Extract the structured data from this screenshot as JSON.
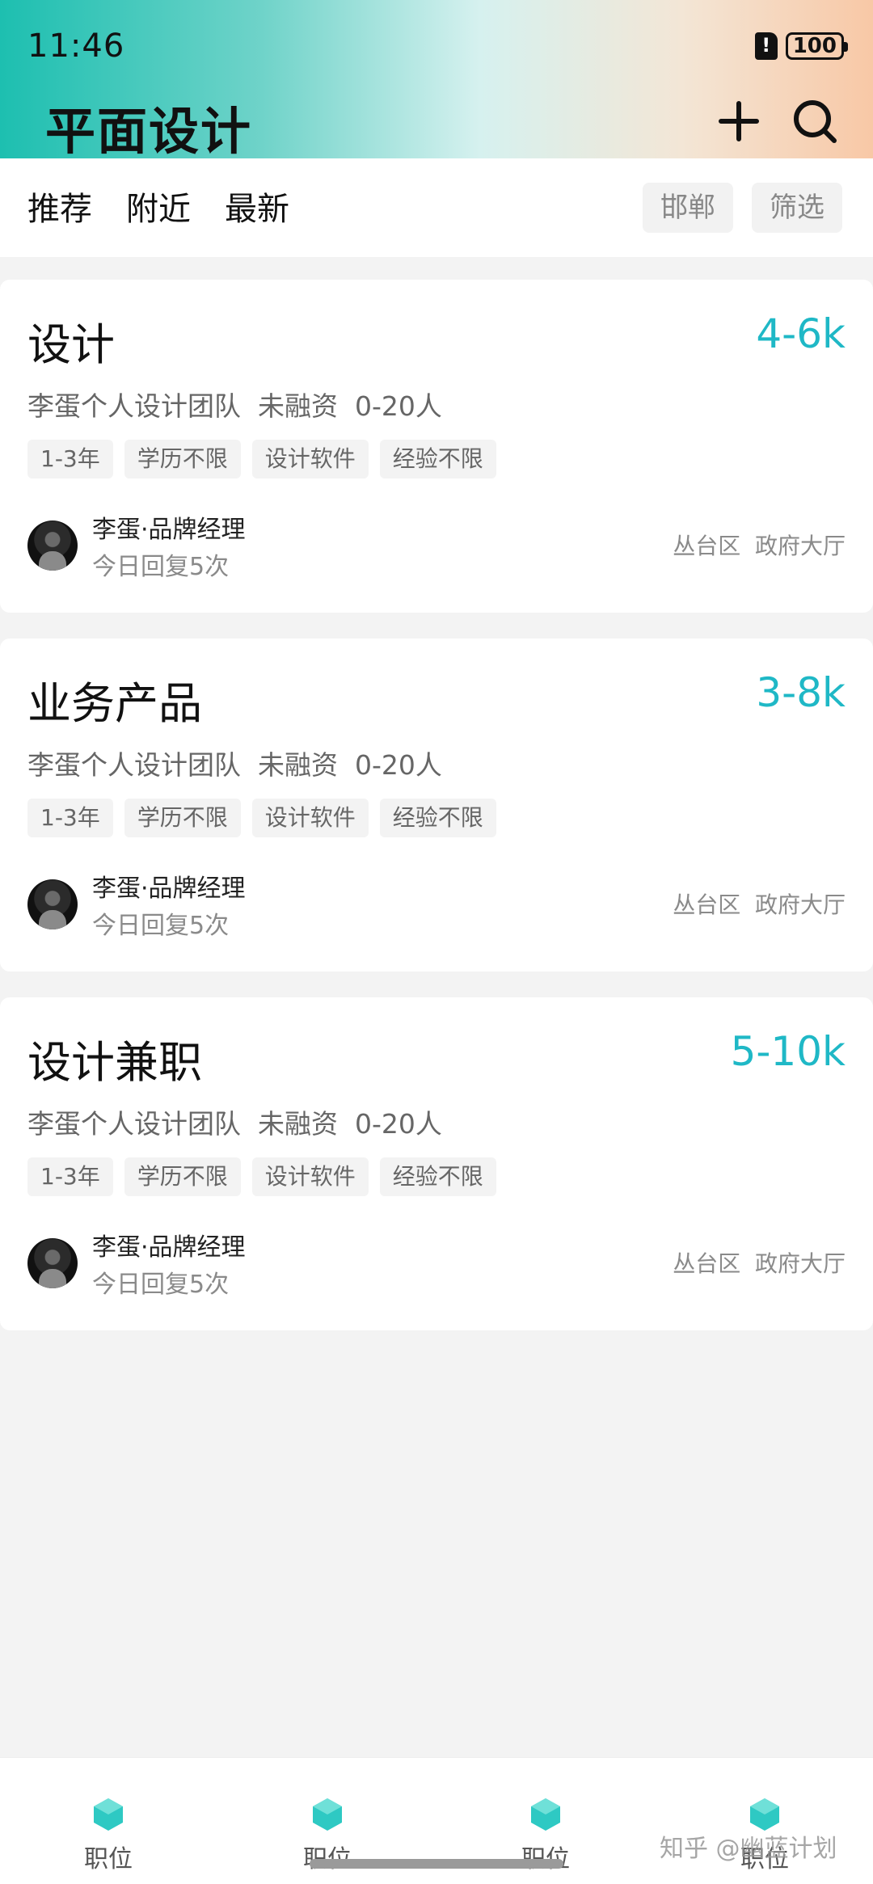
{
  "status_bar": {
    "time": "11:46",
    "battery": "100"
  },
  "header": {
    "title": "平面设计",
    "add_icon": "plus-icon",
    "search_icon": "search-icon"
  },
  "filter_bar": {
    "tabs": [
      "推荐",
      "附近",
      "最新"
    ],
    "city": "邯郸",
    "filter": "筛选"
  },
  "jobs": [
    {
      "title": "设计",
      "salary": "4-6k",
      "company": "李蛋个人设计团队  未融资  0-20人",
      "tags": [
        "1-3年",
        "学历不限",
        "设计软件",
        "经验不限"
      ],
      "recruiter": "李蛋·品牌经理",
      "reply": "今日回复5次",
      "location": "丛台区  政府大厅"
    },
    {
      "title": "业务产品",
      "salary": "3-8k",
      "company": "李蛋个人设计团队  未融资  0-20人",
      "tags": [
        "1-3年",
        "学历不限",
        "设计软件",
        "经验不限"
      ],
      "recruiter": "李蛋·品牌经理",
      "reply": "今日回复5次",
      "location": "丛台区  政府大厅"
    },
    {
      "title": "设计兼职",
      "salary": "5-10k",
      "company": "李蛋个人设计团队  未融资  0-20人",
      "tags": [
        "1-3年",
        "学历不限",
        "设计软件",
        "经验不限"
      ],
      "recruiter": "李蛋·品牌经理",
      "reply": "今日回复5次",
      "location": "丛台区  政府大厅"
    }
  ],
  "bottom_nav": [
    {
      "label": "职位",
      "icon": "hexagon-icon"
    },
    {
      "label": "职位",
      "icon": "hexagon-icon"
    },
    {
      "label": "职位",
      "icon": "hexagon-icon"
    },
    {
      "label": "职位",
      "icon": "hexagon-icon"
    }
  ],
  "watermark": "知乎 @幽蓝计划",
  "colors": {
    "accent": "#1fb8c6",
    "nav_icon": "#2ec9c3"
  }
}
